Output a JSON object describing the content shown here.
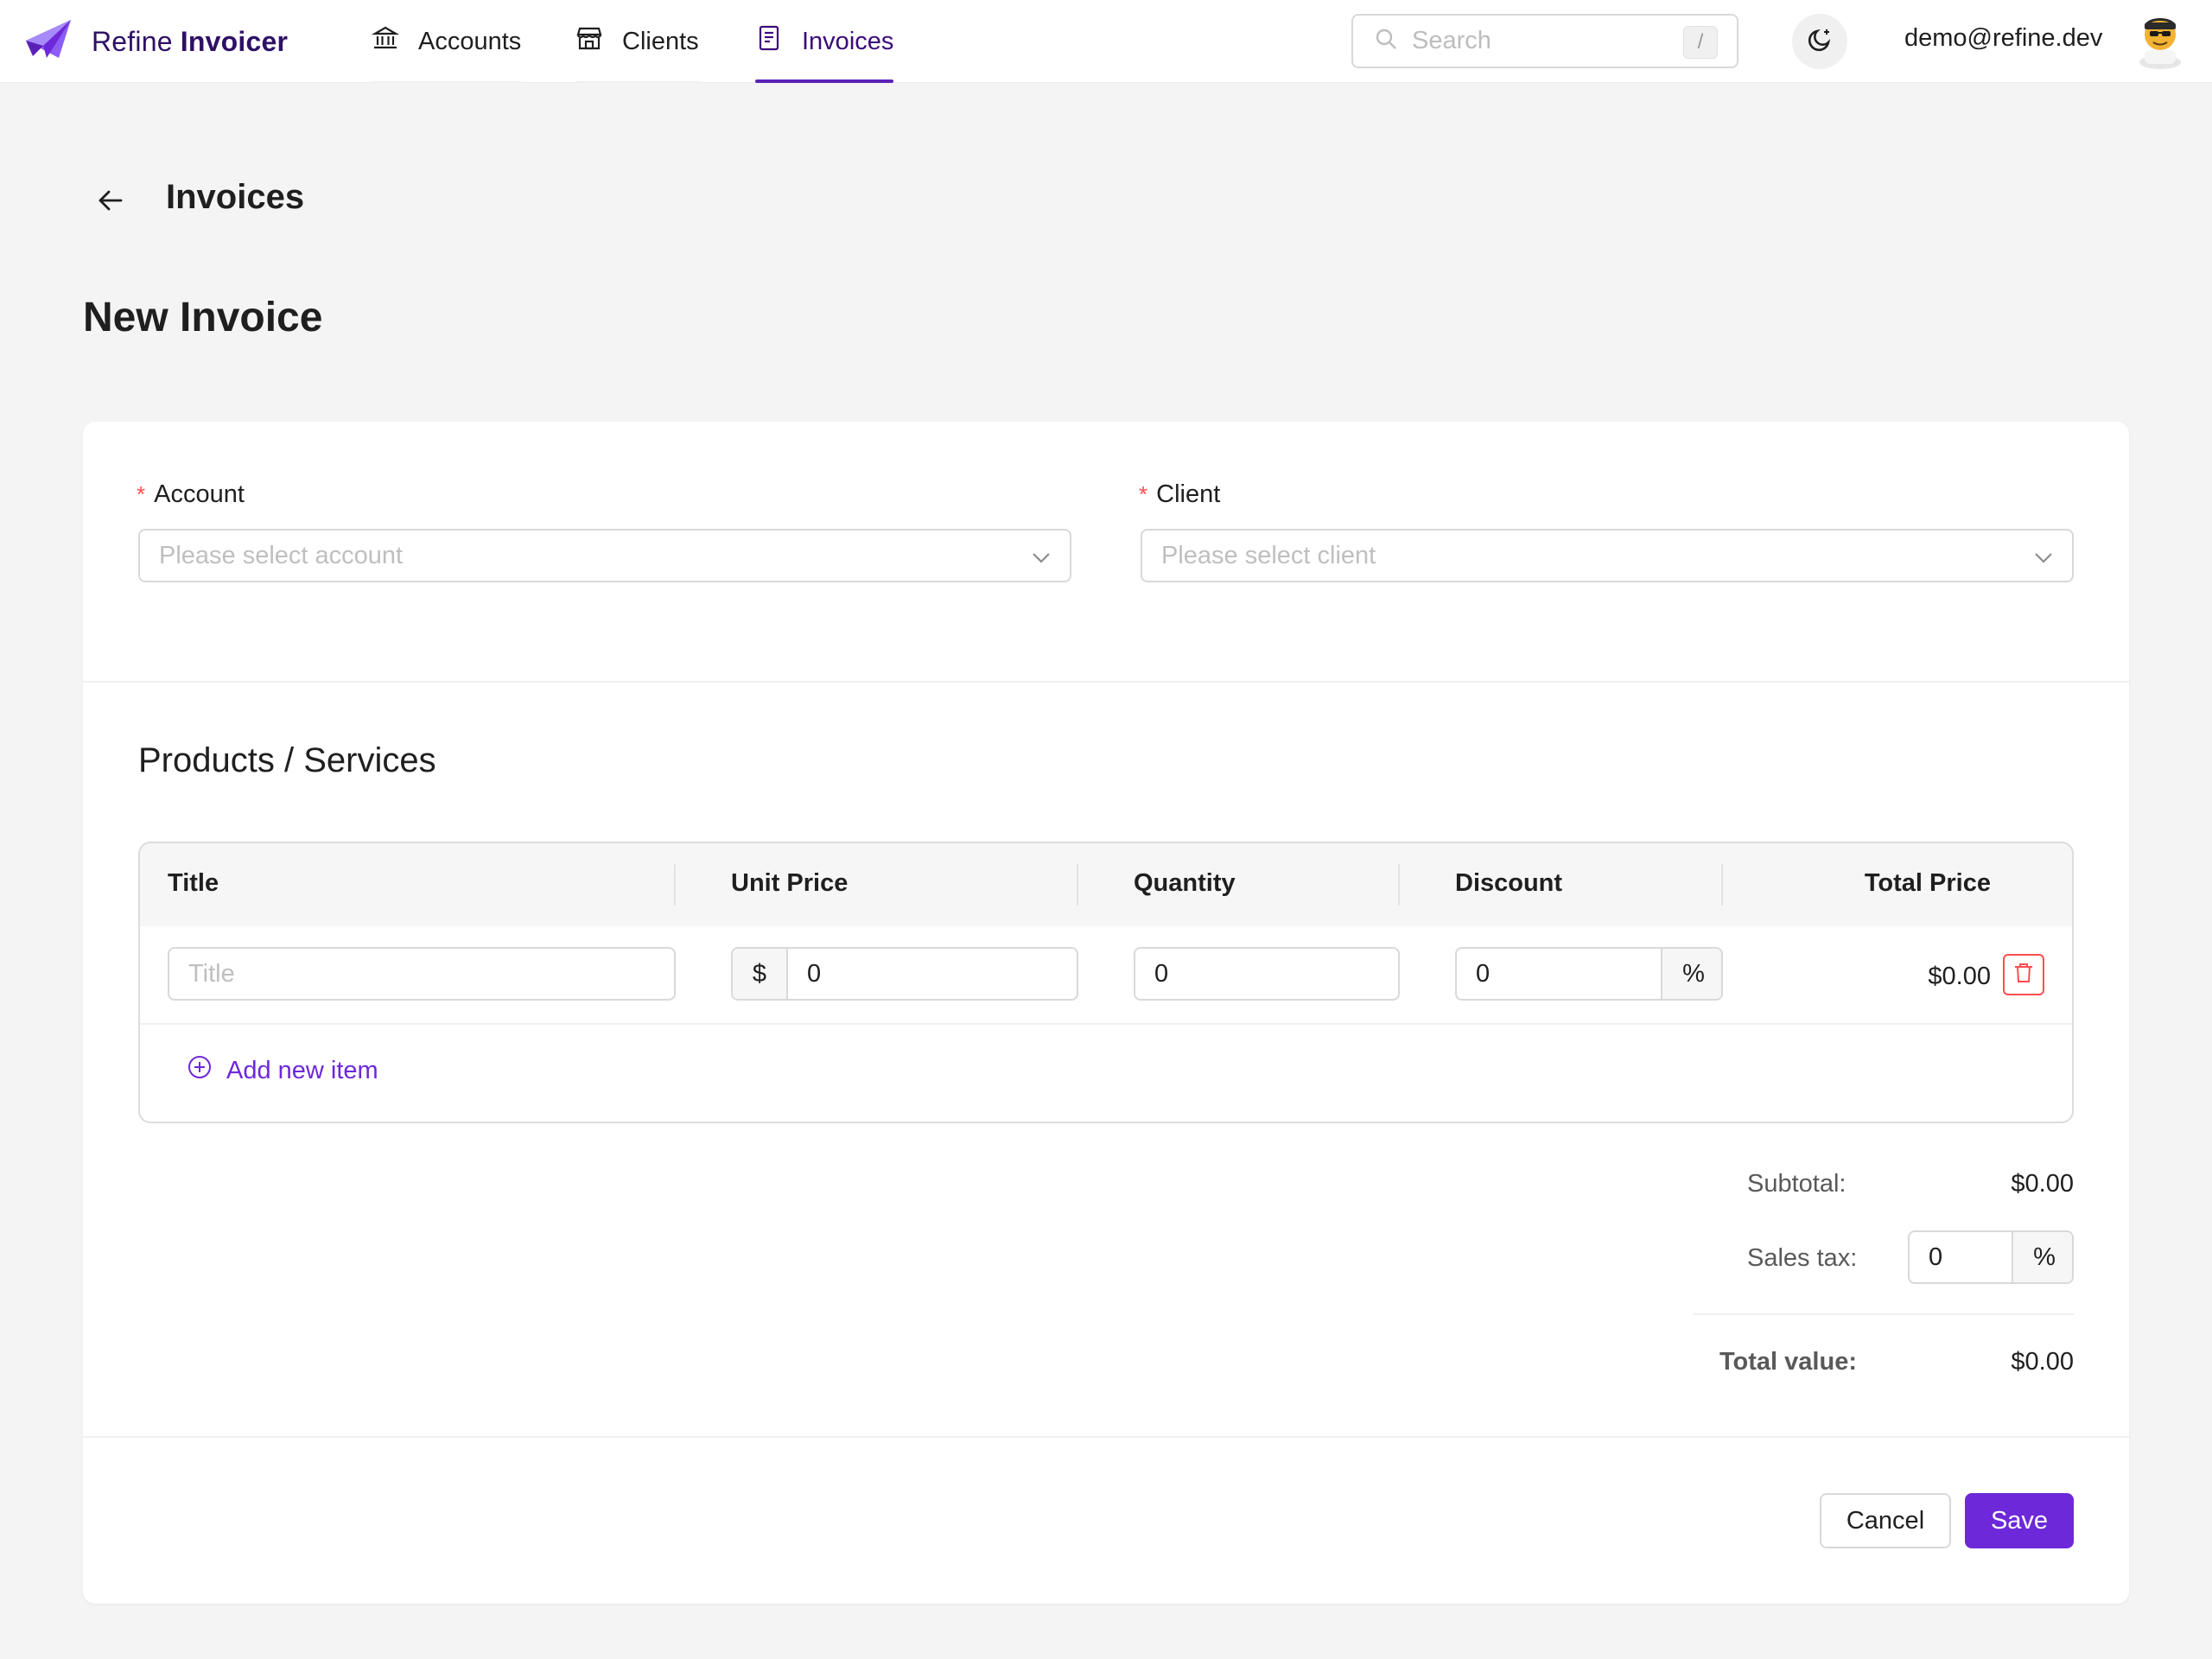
{
  "app": {
    "brand_prefix": "Refine",
    "brand_suffix": "Invoicer"
  },
  "nav": {
    "items": [
      {
        "label": "Accounts",
        "icon": "bank-icon",
        "active": false
      },
      {
        "label": "Clients",
        "icon": "shop-icon",
        "active": false
      },
      {
        "label": "Invoices",
        "icon": "invoice-icon",
        "active": true
      }
    ]
  },
  "search": {
    "placeholder": "Search",
    "shortcut": "/"
  },
  "user": {
    "email": "demo@refine.dev"
  },
  "page": {
    "breadcrumb": "Invoices",
    "title": "New Invoice"
  },
  "form": {
    "account": {
      "label": "Account",
      "required_mark": "*",
      "placeholder": "Please select account"
    },
    "client": {
      "label": "Client",
      "required_mark": "*",
      "placeholder": "Please select client"
    }
  },
  "products": {
    "section_title": "Products / Services",
    "columns": [
      "Title",
      "Unit Price",
      "Quantity",
      "Discount",
      "Total Price"
    ],
    "rows": [
      {
        "title_placeholder": "Title",
        "title_value": "",
        "currency": "$",
        "unit_price": "0",
        "quantity": "0",
        "discount": "0",
        "discount_suffix": "%",
        "total": "$0.00"
      }
    ],
    "add_label": "Add new item"
  },
  "summary": {
    "subtotal_label": "Subtotal:",
    "subtotal_value": "$0.00",
    "tax_label": "Sales tax:",
    "tax_value": "0",
    "tax_suffix": "%",
    "total_label": "Total value:",
    "total_value": "$0.00"
  },
  "actions": {
    "cancel": "Cancel",
    "save": "Save"
  },
  "colors": {
    "accent": "#6d28d9",
    "brand_text": "#2e1065",
    "danger": "#ff4d4f",
    "background": "#f4f4f4"
  }
}
